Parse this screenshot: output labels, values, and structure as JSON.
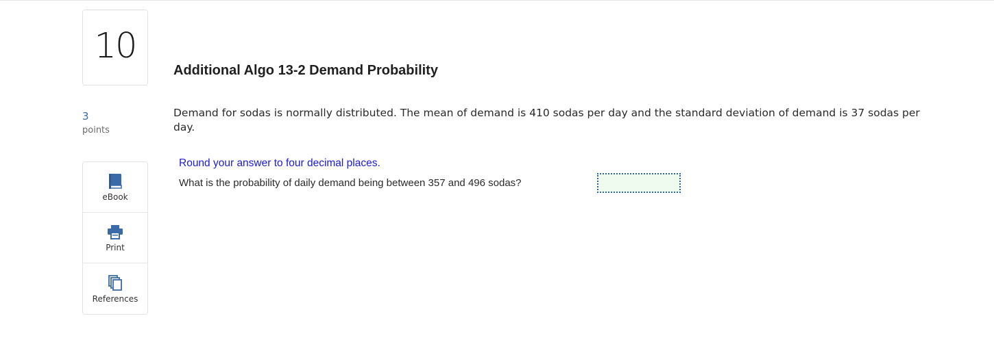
{
  "question": {
    "number": "10",
    "points_value": "3",
    "points_label": "points",
    "title": "Additional Algo 13-2 Demand Probability",
    "problem_text": "Demand for sodas is normally distributed. The mean of demand is 410 sodas per day and the standard deviation of demand is 37 sodas per day.",
    "instruction": "Round your answer to four decimal places.",
    "prompt": "What is the probability of daily demand being between 357 and 496 sodas?",
    "answer_value": ""
  },
  "tools": {
    "items": [
      {
        "label": "eBook",
        "icon": "book-icon"
      },
      {
        "label": "Print",
        "icon": "printer-icon"
      },
      {
        "label": "References",
        "icon": "references-icon"
      }
    ]
  },
  "colors": {
    "accent_blue": "#3a6aa8",
    "instruction_blue": "#1a1add",
    "answer_bg": "#f0fbf0",
    "answer_border": "#2b5fa8"
  }
}
